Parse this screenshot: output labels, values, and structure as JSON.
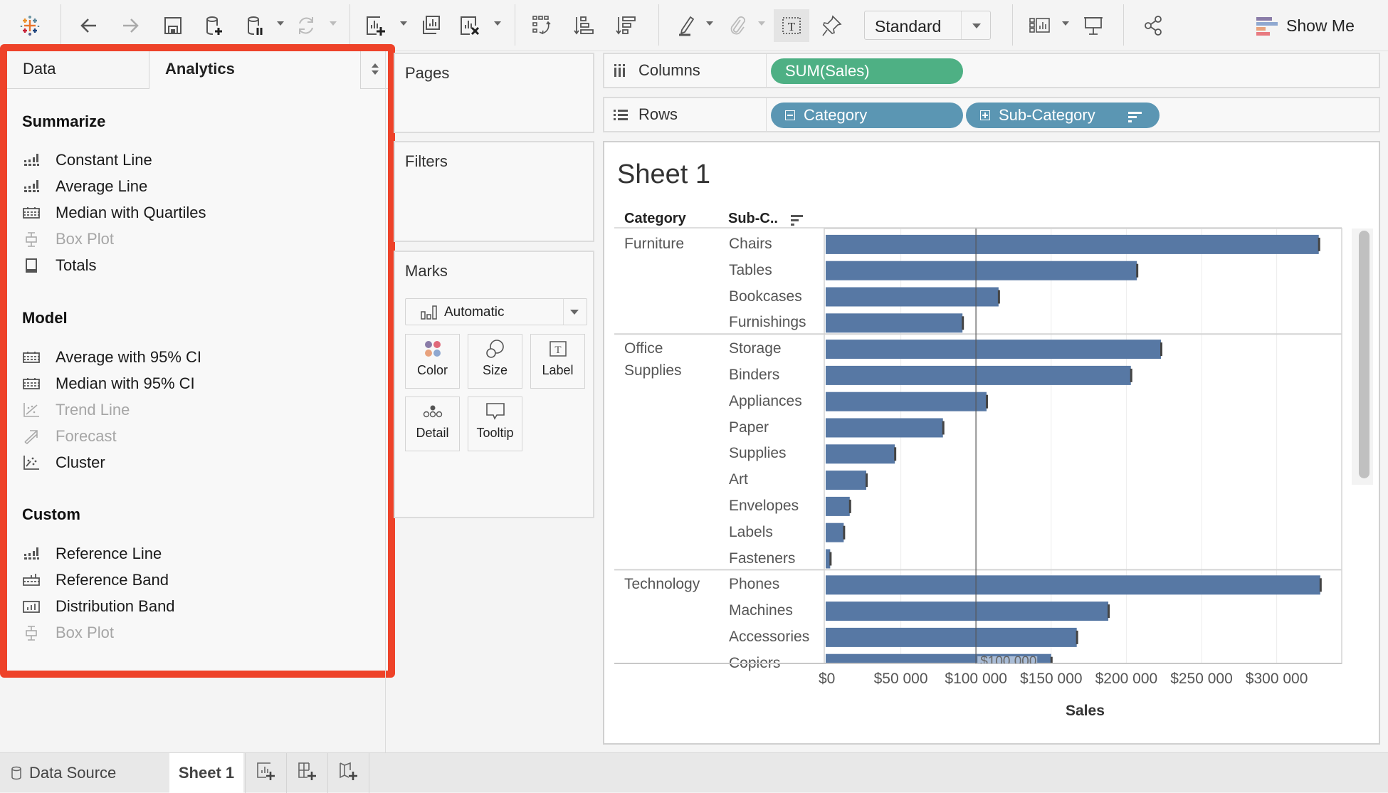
{
  "toolbar": {
    "view_mode": "Standard",
    "show_me": "Show Me",
    "icons": [
      "tableau-logo-icon",
      "back-arrow-icon",
      "forward-arrow-icon",
      "save-icon",
      "new-data-source-icon",
      "pause-updates-icon",
      "refresh-icon",
      "new-worksheet-icon",
      "duplicate-sheet-icon",
      "clear-sheet-icon",
      "swap-rows-columns-icon",
      "sort-ascending-icon",
      "sort-descending-icon",
      "highlight-icon",
      "group-members-icon",
      "show-mark-labels-icon",
      "fix-axes-icon",
      "show-cards-icon",
      "presentation-mode-icon",
      "share-icon"
    ],
    "show_me_colors": [
      "#8a7ca8",
      "#8fa8d0",
      "#e8a27d",
      "#e87a80"
    ]
  },
  "side_pane": {
    "tabs": [
      {
        "label": "Data",
        "active": false
      },
      {
        "label": "Analytics",
        "active": true
      }
    ],
    "highlight_color": "#ee4229",
    "sections": [
      {
        "title": "Summarize",
        "items": [
          {
            "label": "Constant Line",
            "icon": "constant-line-icon",
            "enabled": true
          },
          {
            "label": "Average Line",
            "icon": "average-line-icon",
            "enabled": true
          },
          {
            "label": "Median with Quartiles",
            "icon": "median-quartiles-icon",
            "enabled": true
          },
          {
            "label": "Box Plot",
            "icon": "box-plot-icon",
            "enabled": false
          },
          {
            "label": "Totals",
            "icon": "totals-icon",
            "enabled": true
          }
        ]
      },
      {
        "title": "Model",
        "items": [
          {
            "label": "Average with 95% CI",
            "icon": "average-ci-icon",
            "enabled": true
          },
          {
            "label": "Median with 95% CI",
            "icon": "median-ci-icon",
            "enabled": true
          },
          {
            "label": "Trend Line",
            "icon": "trend-line-icon",
            "enabled": false
          },
          {
            "label": "Forecast",
            "icon": "forecast-icon",
            "enabled": false
          },
          {
            "label": "Cluster",
            "icon": "cluster-icon",
            "enabled": true
          }
        ]
      },
      {
        "title": "Custom",
        "items": [
          {
            "label": "Reference Line",
            "icon": "reference-line-icon",
            "enabled": true
          },
          {
            "label": "Reference Band",
            "icon": "reference-band-icon",
            "enabled": true
          },
          {
            "label": "Distribution Band",
            "icon": "distribution-band-icon",
            "enabled": true
          },
          {
            "label": "Box Plot",
            "icon": "box-plot-icon",
            "enabled": false
          }
        ]
      }
    ]
  },
  "cards": {
    "pages": "Pages",
    "filters": "Filters",
    "marks": {
      "title": "Marks",
      "type": "Automatic",
      "buttons": [
        "Color",
        "Size",
        "Label",
        "Detail",
        "Tooltip"
      ],
      "color_dots": [
        "#8a7ca8",
        "#e0697a",
        "#e8a27d",
        "#8fa8d0"
      ]
    }
  },
  "shelves": {
    "columns": {
      "label": "Columns",
      "pills": [
        {
          "text": "SUM(Sales)",
          "color": "#4eb084"
        }
      ]
    },
    "rows": {
      "label": "Rows",
      "pills": [
        {
          "text": "Category",
          "color": "#5b96b3"
        },
        {
          "text": "Sub-Category",
          "color": "#5b96b3"
        }
      ]
    }
  },
  "sheet": {
    "title": "Sheet 1",
    "headers": {
      "category": "Category",
      "subcategory": "Sub-C.."
    },
    "reference_line_label": "$100 000"
  },
  "chart_data": {
    "type": "bar",
    "orientation": "horizontal",
    "title": "Sheet 1",
    "xlabel": "Sales",
    "ylabel": "",
    "xlim": [
      0,
      350000
    ],
    "x_ticks": [
      0,
      50000,
      100000,
      150000,
      200000,
      250000,
      300000
    ],
    "x_tick_labels": [
      "$0",
      "$50 000",
      "$100 000",
      "$150 000",
      "$200 000",
      "$250 000",
      "$300 000"
    ],
    "bar_color": "#5778a4",
    "grid": true,
    "reference_line": {
      "value": 100000,
      "label": "$100 000"
    },
    "groups": [
      {
        "category": "Furniture",
        "label_lines": [
          "Furniture"
        ],
        "rows": [
          {
            "sub": "Chairs",
            "value": 328000
          },
          {
            "sub": "Tables",
            "value": 207000
          },
          {
            "sub": "Bookcases",
            "value": 115000
          },
          {
            "sub": "Furnishings",
            "value": 91000
          }
        ]
      },
      {
        "category": "Office Supplies",
        "label_lines": [
          "Office",
          "Supplies"
        ],
        "rows": [
          {
            "sub": "Storage",
            "value": 223000
          },
          {
            "sub": "Binders",
            "value": 203000
          },
          {
            "sub": "Appliances",
            "value": 107000
          },
          {
            "sub": "Paper",
            "value": 78000
          },
          {
            "sub": "Supplies",
            "value": 46000
          },
          {
            "sub": "Art",
            "value": 27000
          },
          {
            "sub": "Envelopes",
            "value": 16000
          },
          {
            "sub": "Labels",
            "value": 12000
          },
          {
            "sub": "Fasteners",
            "value": 3000
          }
        ]
      },
      {
        "category": "Technology",
        "label_lines": [
          "Technology"
        ],
        "rows": [
          {
            "sub": "Phones",
            "value": 329000
          },
          {
            "sub": "Machines",
            "value": 188000
          },
          {
            "sub": "Accessories",
            "value": 167000
          },
          {
            "sub": "Copiers",
            "value": 150000
          }
        ]
      }
    ]
  },
  "bottom_bar": {
    "data_source": "Data Source",
    "sheet_tab": "Sheet 1"
  }
}
